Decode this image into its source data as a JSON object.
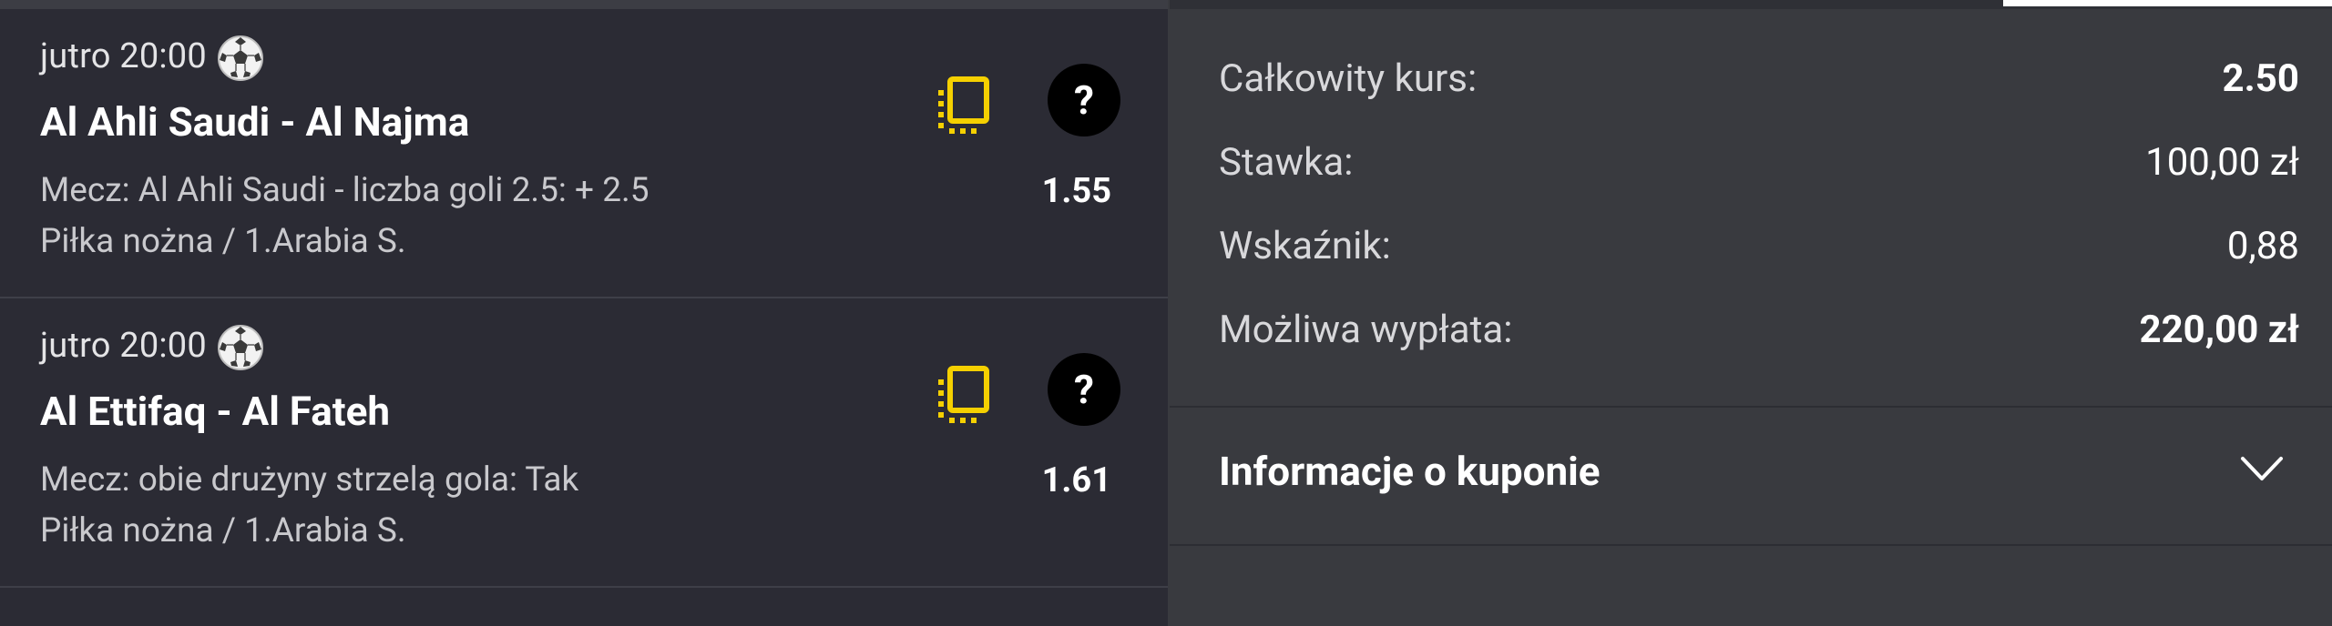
{
  "bets": [
    {
      "time": "jutro 20:00",
      "sport_icon": "soccer-ball-icon",
      "title": "Al Ahli Saudi - Al Najma",
      "market": "Mecz: Al Ahli Saudi - liczba goli 2.5: + 2.5",
      "odd": "1.55",
      "league": "Piłka nożna / 1.Arabia S."
    },
    {
      "time": "jutro 20:00",
      "sport_icon": "soccer-ball-icon",
      "title": "Al Ettifaq - Al Fateh",
      "market": "Mecz: obie drużyny strzelą gola: Tak",
      "odd": "1.61",
      "league": "Piłka nożna / 1.Arabia S."
    }
  ],
  "summary": {
    "total_odds_label": "Całkowity kurs:",
    "total_odds_value": "2.50",
    "stake_label": "Stawka:",
    "stake_value": "100,00 zł",
    "factor_label": "Wskaźnik:",
    "factor_value": "0,88",
    "payout_label": "Możliwa wypłata:",
    "payout_value": "220,00 zł"
  },
  "coupon_info": {
    "label": "Informacje o kuponie"
  },
  "colors": {
    "accent_yellow": "#f5d000",
    "left_bg": "#2b2b34",
    "right_bg": "#393a3f"
  },
  "icons": {
    "help": "?",
    "copy": "copy-coupon-icon",
    "chevron": "chevron-down-icon"
  }
}
